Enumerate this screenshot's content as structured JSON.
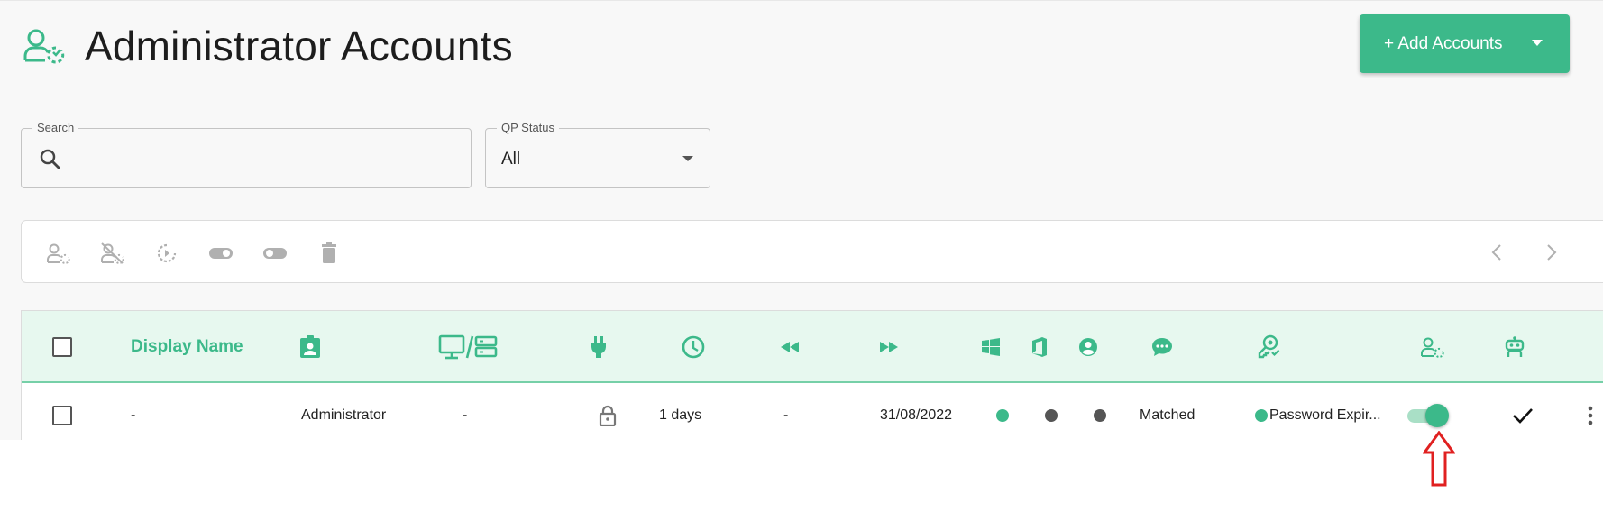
{
  "page": {
    "title": "Administrator Accounts",
    "icon": "admin-accounts-icon",
    "accent_color": "#3cb98a"
  },
  "header": {
    "add_button_label": "+ Add Accounts"
  },
  "filters": {
    "search": {
      "label": "Search",
      "value": "",
      "placeholder": ""
    },
    "qp_status": {
      "label": "QP Status",
      "selected": "All"
    }
  },
  "toolbar": {
    "icons": [
      "enable-quick-password-icon",
      "disable-quick-password-icon",
      "reset-password-icon",
      "toggle-on-icon",
      "toggle-off-icon",
      "delete-icon"
    ],
    "nav": [
      "chevron-left-icon",
      "chevron-right-icon"
    ]
  },
  "table": {
    "header": {
      "display_name": "Display Name",
      "icons": [
        "contact-badge-icon",
        "computer-server-icon",
        "plug-icon",
        "clock-icon",
        "rewind-icon",
        "fast-forward-icon",
        "windows-icon",
        "office-icon",
        "user-circle-icon",
        "chat-icon",
        "key-badge-icon",
        "user-gear-icon",
        "robot-icon"
      ]
    },
    "rows": [
      {
        "display_name": "-",
        "role": "Administrator",
        "computer": "-",
        "plug": "lock-icon",
        "duration": "1 days",
        "previous": "-",
        "next_date": "31/08/2022",
        "windows_status": "green",
        "office_status": "gray",
        "user_status": "gray",
        "chat_status": "Matched",
        "policy_status": "green",
        "policy": "Password Expir...",
        "enabled": true,
        "robot": "check-icon",
        "menu": "more-vert-icon"
      }
    ]
  },
  "annotation": {
    "color": "#e02020",
    "icon": "up-arrow-icon"
  }
}
